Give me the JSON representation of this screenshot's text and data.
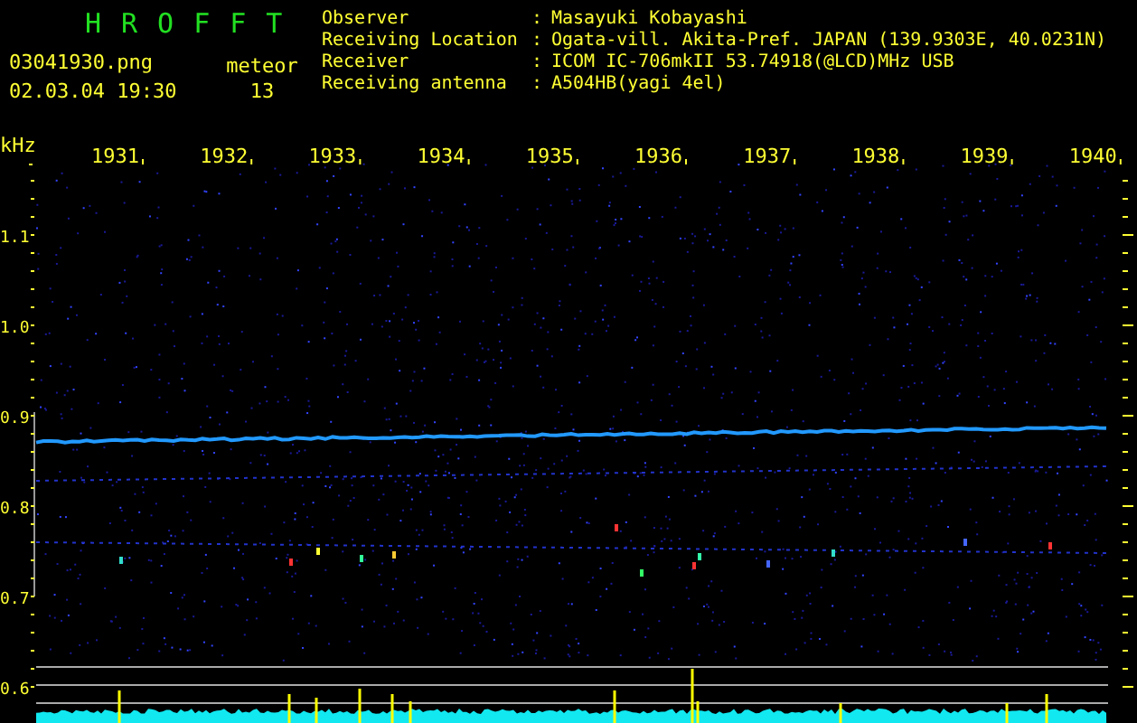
{
  "app": {
    "title": "HROFFT",
    "file": "03041930.png",
    "datetime": "02.03.04 19:30",
    "count_label": "meteor",
    "count": "13"
  },
  "info": [
    {
      "label": "Observer",
      "separator": ":",
      "value": "Masayuki Kobayashi"
    },
    {
      "label": "Receiving Location",
      "separator": ":",
      "value": "Ogata-vill. Akita-Pref. JAPAN (139.9303E, 40.0231N)"
    },
    {
      "label": "Receiver",
      "separator": ":",
      "value": "ICOM IC-706mkII 53.74918(@LCD)MHz USB"
    },
    {
      "label": "Receiving antenna",
      "separator": ":",
      "value": "A504HB(yagi 4el)"
    }
  ],
  "spectrogram": {
    "unit": "kHz",
    "time_labels": [
      "1931",
      "1932",
      "1933",
      "1934",
      "1935",
      "1936",
      "1937",
      "1938",
      "1939",
      "1940"
    ],
    "freq_labels": [
      "1.1",
      "1.0",
      "0.9",
      "0.8",
      "0.7",
      "0.6"
    ]
  }
}
